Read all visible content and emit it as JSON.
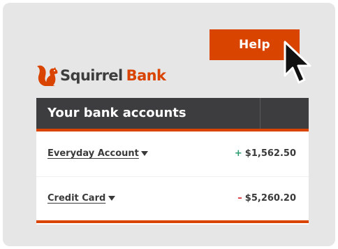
{
  "help_button": {
    "label": "Help"
  },
  "brand": {
    "name_part1": "Squirrel",
    "name_part2": "Bank",
    "logo_icon": "squirrel-icon"
  },
  "accounts_panel": {
    "title": "Your bank accounts",
    "accounts": [
      {
        "name": "Everyday Account",
        "sign": "+",
        "amount": "$1,562.50",
        "sign_color": "#2a9d6e"
      },
      {
        "name": "Credit Card",
        "sign": "–",
        "amount": "$5,260.20",
        "sign_color": "#d9252b"
      }
    ]
  },
  "colors": {
    "accent": "#d94400",
    "header_bg": "#3d3d3f",
    "page_bg": "#e6e6e6"
  }
}
